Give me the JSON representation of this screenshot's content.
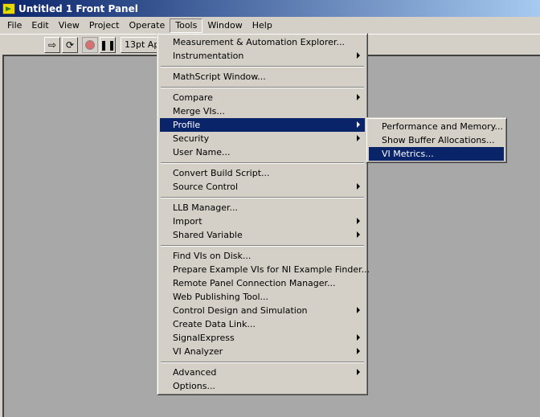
{
  "title": "Untitled 1 Front Panel",
  "menubar": [
    "File",
    "Edit",
    "View",
    "Project",
    "Operate",
    "Tools",
    "Window",
    "Help"
  ],
  "toolbar": {
    "font": "13pt Ap"
  },
  "tools_menu": [
    {
      "label": "Measurement & Automation Explorer..."
    },
    {
      "label": "Instrumentation",
      "submenu": true
    },
    {
      "sep": true
    },
    {
      "label": "MathScript Window..."
    },
    {
      "sep": true
    },
    {
      "label": "Compare",
      "submenu": true
    },
    {
      "label": "Merge VIs..."
    },
    {
      "label": "Profile",
      "submenu": true,
      "selected": true
    },
    {
      "label": "Security",
      "submenu": true
    },
    {
      "label": "User Name..."
    },
    {
      "sep": true
    },
    {
      "label": "Convert Build Script..."
    },
    {
      "label": "Source Control",
      "submenu": true
    },
    {
      "sep": true
    },
    {
      "label": "LLB Manager..."
    },
    {
      "label": "Import",
      "submenu": true
    },
    {
      "label": "Shared Variable",
      "submenu": true
    },
    {
      "sep": true
    },
    {
      "label": "Find VIs on Disk..."
    },
    {
      "label": "Prepare Example VIs for NI Example Finder..."
    },
    {
      "label": "Remote Panel Connection Manager..."
    },
    {
      "label": "Web Publishing Tool..."
    },
    {
      "label": "Control Design and Simulation",
      "submenu": true
    },
    {
      "label": "Create Data Link..."
    },
    {
      "label": "SignalExpress",
      "submenu": true
    },
    {
      "label": "VI Analyzer",
      "submenu": true
    },
    {
      "sep": true
    },
    {
      "label": "Advanced",
      "submenu": true
    },
    {
      "label": "Options..."
    }
  ],
  "profile_submenu": [
    {
      "label": "Performance and Memory..."
    },
    {
      "label": "Show Buffer Allocations..."
    },
    {
      "label": "VI Metrics...",
      "selected": true
    }
  ]
}
